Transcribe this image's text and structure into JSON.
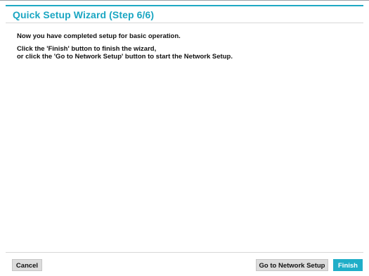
{
  "wizard": {
    "title": "Quick Setup Wizard (Step 6/6)",
    "message": {
      "line1": "Now you have completed setup for basic operation.",
      "line2": "Click the 'Finish' button to finish the wizard,",
      "line3": "or click the 'Go to Network Setup' button to start the Network Setup."
    },
    "buttons": {
      "cancel": "Cancel",
      "network_setup": "Go to Network Setup",
      "finish": "Finish"
    }
  },
  "colors": {
    "accent": "#1aa6c2",
    "button_gray": "#dcdcdc",
    "finish_button": "#1faec8"
  }
}
